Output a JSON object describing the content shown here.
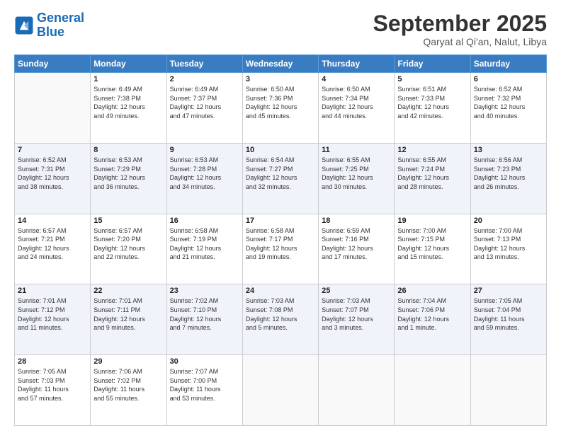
{
  "logo": {
    "line1": "General",
    "line2": "Blue"
  },
  "header": {
    "month": "September 2025",
    "location": "Qaryat al Qi'an, Nalut, Libya"
  },
  "weekdays": [
    "Sunday",
    "Monday",
    "Tuesday",
    "Wednesday",
    "Thursday",
    "Friday",
    "Saturday"
  ],
  "weeks": [
    [
      {
        "day": "",
        "info": ""
      },
      {
        "day": "1",
        "info": "Sunrise: 6:49 AM\nSunset: 7:38 PM\nDaylight: 12 hours\nand 49 minutes."
      },
      {
        "day": "2",
        "info": "Sunrise: 6:49 AM\nSunset: 7:37 PM\nDaylight: 12 hours\nand 47 minutes."
      },
      {
        "day": "3",
        "info": "Sunrise: 6:50 AM\nSunset: 7:36 PM\nDaylight: 12 hours\nand 45 minutes."
      },
      {
        "day": "4",
        "info": "Sunrise: 6:50 AM\nSunset: 7:34 PM\nDaylight: 12 hours\nand 44 minutes."
      },
      {
        "day": "5",
        "info": "Sunrise: 6:51 AM\nSunset: 7:33 PM\nDaylight: 12 hours\nand 42 minutes."
      },
      {
        "day": "6",
        "info": "Sunrise: 6:52 AM\nSunset: 7:32 PM\nDaylight: 12 hours\nand 40 minutes."
      }
    ],
    [
      {
        "day": "7",
        "info": "Sunrise: 6:52 AM\nSunset: 7:31 PM\nDaylight: 12 hours\nand 38 minutes."
      },
      {
        "day": "8",
        "info": "Sunrise: 6:53 AM\nSunset: 7:29 PM\nDaylight: 12 hours\nand 36 minutes."
      },
      {
        "day": "9",
        "info": "Sunrise: 6:53 AM\nSunset: 7:28 PM\nDaylight: 12 hours\nand 34 minutes."
      },
      {
        "day": "10",
        "info": "Sunrise: 6:54 AM\nSunset: 7:27 PM\nDaylight: 12 hours\nand 32 minutes."
      },
      {
        "day": "11",
        "info": "Sunrise: 6:55 AM\nSunset: 7:25 PM\nDaylight: 12 hours\nand 30 minutes."
      },
      {
        "day": "12",
        "info": "Sunrise: 6:55 AM\nSunset: 7:24 PM\nDaylight: 12 hours\nand 28 minutes."
      },
      {
        "day": "13",
        "info": "Sunrise: 6:56 AM\nSunset: 7:23 PM\nDaylight: 12 hours\nand 26 minutes."
      }
    ],
    [
      {
        "day": "14",
        "info": "Sunrise: 6:57 AM\nSunset: 7:21 PM\nDaylight: 12 hours\nand 24 minutes."
      },
      {
        "day": "15",
        "info": "Sunrise: 6:57 AM\nSunset: 7:20 PM\nDaylight: 12 hours\nand 22 minutes."
      },
      {
        "day": "16",
        "info": "Sunrise: 6:58 AM\nSunset: 7:19 PM\nDaylight: 12 hours\nand 21 minutes."
      },
      {
        "day": "17",
        "info": "Sunrise: 6:58 AM\nSunset: 7:17 PM\nDaylight: 12 hours\nand 19 minutes."
      },
      {
        "day": "18",
        "info": "Sunrise: 6:59 AM\nSunset: 7:16 PM\nDaylight: 12 hours\nand 17 minutes."
      },
      {
        "day": "19",
        "info": "Sunrise: 7:00 AM\nSunset: 7:15 PM\nDaylight: 12 hours\nand 15 minutes."
      },
      {
        "day": "20",
        "info": "Sunrise: 7:00 AM\nSunset: 7:13 PM\nDaylight: 12 hours\nand 13 minutes."
      }
    ],
    [
      {
        "day": "21",
        "info": "Sunrise: 7:01 AM\nSunset: 7:12 PM\nDaylight: 12 hours\nand 11 minutes."
      },
      {
        "day": "22",
        "info": "Sunrise: 7:01 AM\nSunset: 7:11 PM\nDaylight: 12 hours\nand 9 minutes."
      },
      {
        "day": "23",
        "info": "Sunrise: 7:02 AM\nSunset: 7:10 PM\nDaylight: 12 hours\nand 7 minutes."
      },
      {
        "day": "24",
        "info": "Sunrise: 7:03 AM\nSunset: 7:08 PM\nDaylight: 12 hours\nand 5 minutes."
      },
      {
        "day": "25",
        "info": "Sunrise: 7:03 AM\nSunset: 7:07 PM\nDaylight: 12 hours\nand 3 minutes."
      },
      {
        "day": "26",
        "info": "Sunrise: 7:04 AM\nSunset: 7:06 PM\nDaylight: 12 hours\nand 1 minute."
      },
      {
        "day": "27",
        "info": "Sunrise: 7:05 AM\nSunset: 7:04 PM\nDaylight: 11 hours\nand 59 minutes."
      }
    ],
    [
      {
        "day": "28",
        "info": "Sunrise: 7:05 AM\nSunset: 7:03 PM\nDaylight: 11 hours\nand 57 minutes."
      },
      {
        "day": "29",
        "info": "Sunrise: 7:06 AM\nSunset: 7:02 PM\nDaylight: 11 hours\nand 55 minutes."
      },
      {
        "day": "30",
        "info": "Sunrise: 7:07 AM\nSunset: 7:00 PM\nDaylight: 11 hours\nand 53 minutes."
      },
      {
        "day": "",
        "info": ""
      },
      {
        "day": "",
        "info": ""
      },
      {
        "day": "",
        "info": ""
      },
      {
        "day": "",
        "info": ""
      }
    ]
  ]
}
